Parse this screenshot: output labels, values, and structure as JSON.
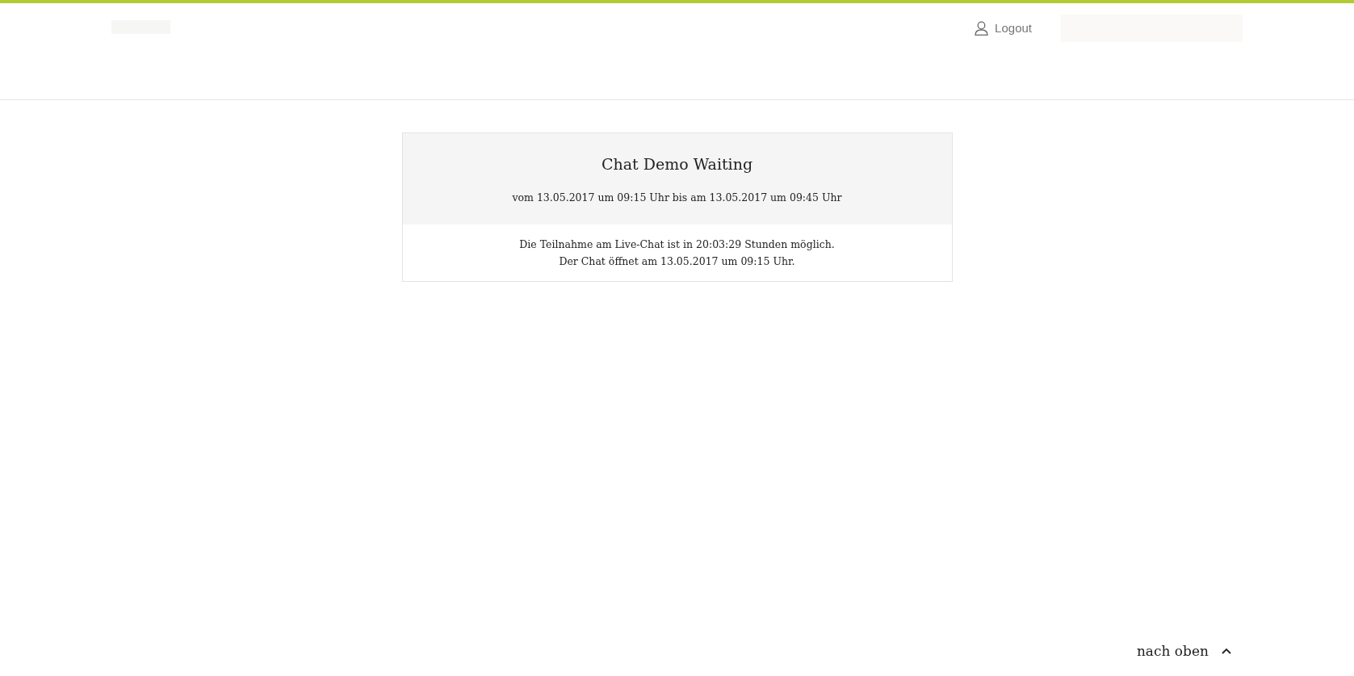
{
  "header": {
    "logout": "Logout"
  },
  "event": {
    "title": "Chat Demo Waiting",
    "period": "vom 13.05.2017 um 09:15 Uhr bis am 13.05.2017 um 09:45 Uhr",
    "messages": [
      "Die Teilnahme am Live-Chat ist in 20:03:29 Stunden möglich.",
      "Der Chat öffnet am 13.05.2017 um 09:15 Uhr."
    ]
  },
  "footer": {
    "back_to_top": "nach oben"
  }
}
